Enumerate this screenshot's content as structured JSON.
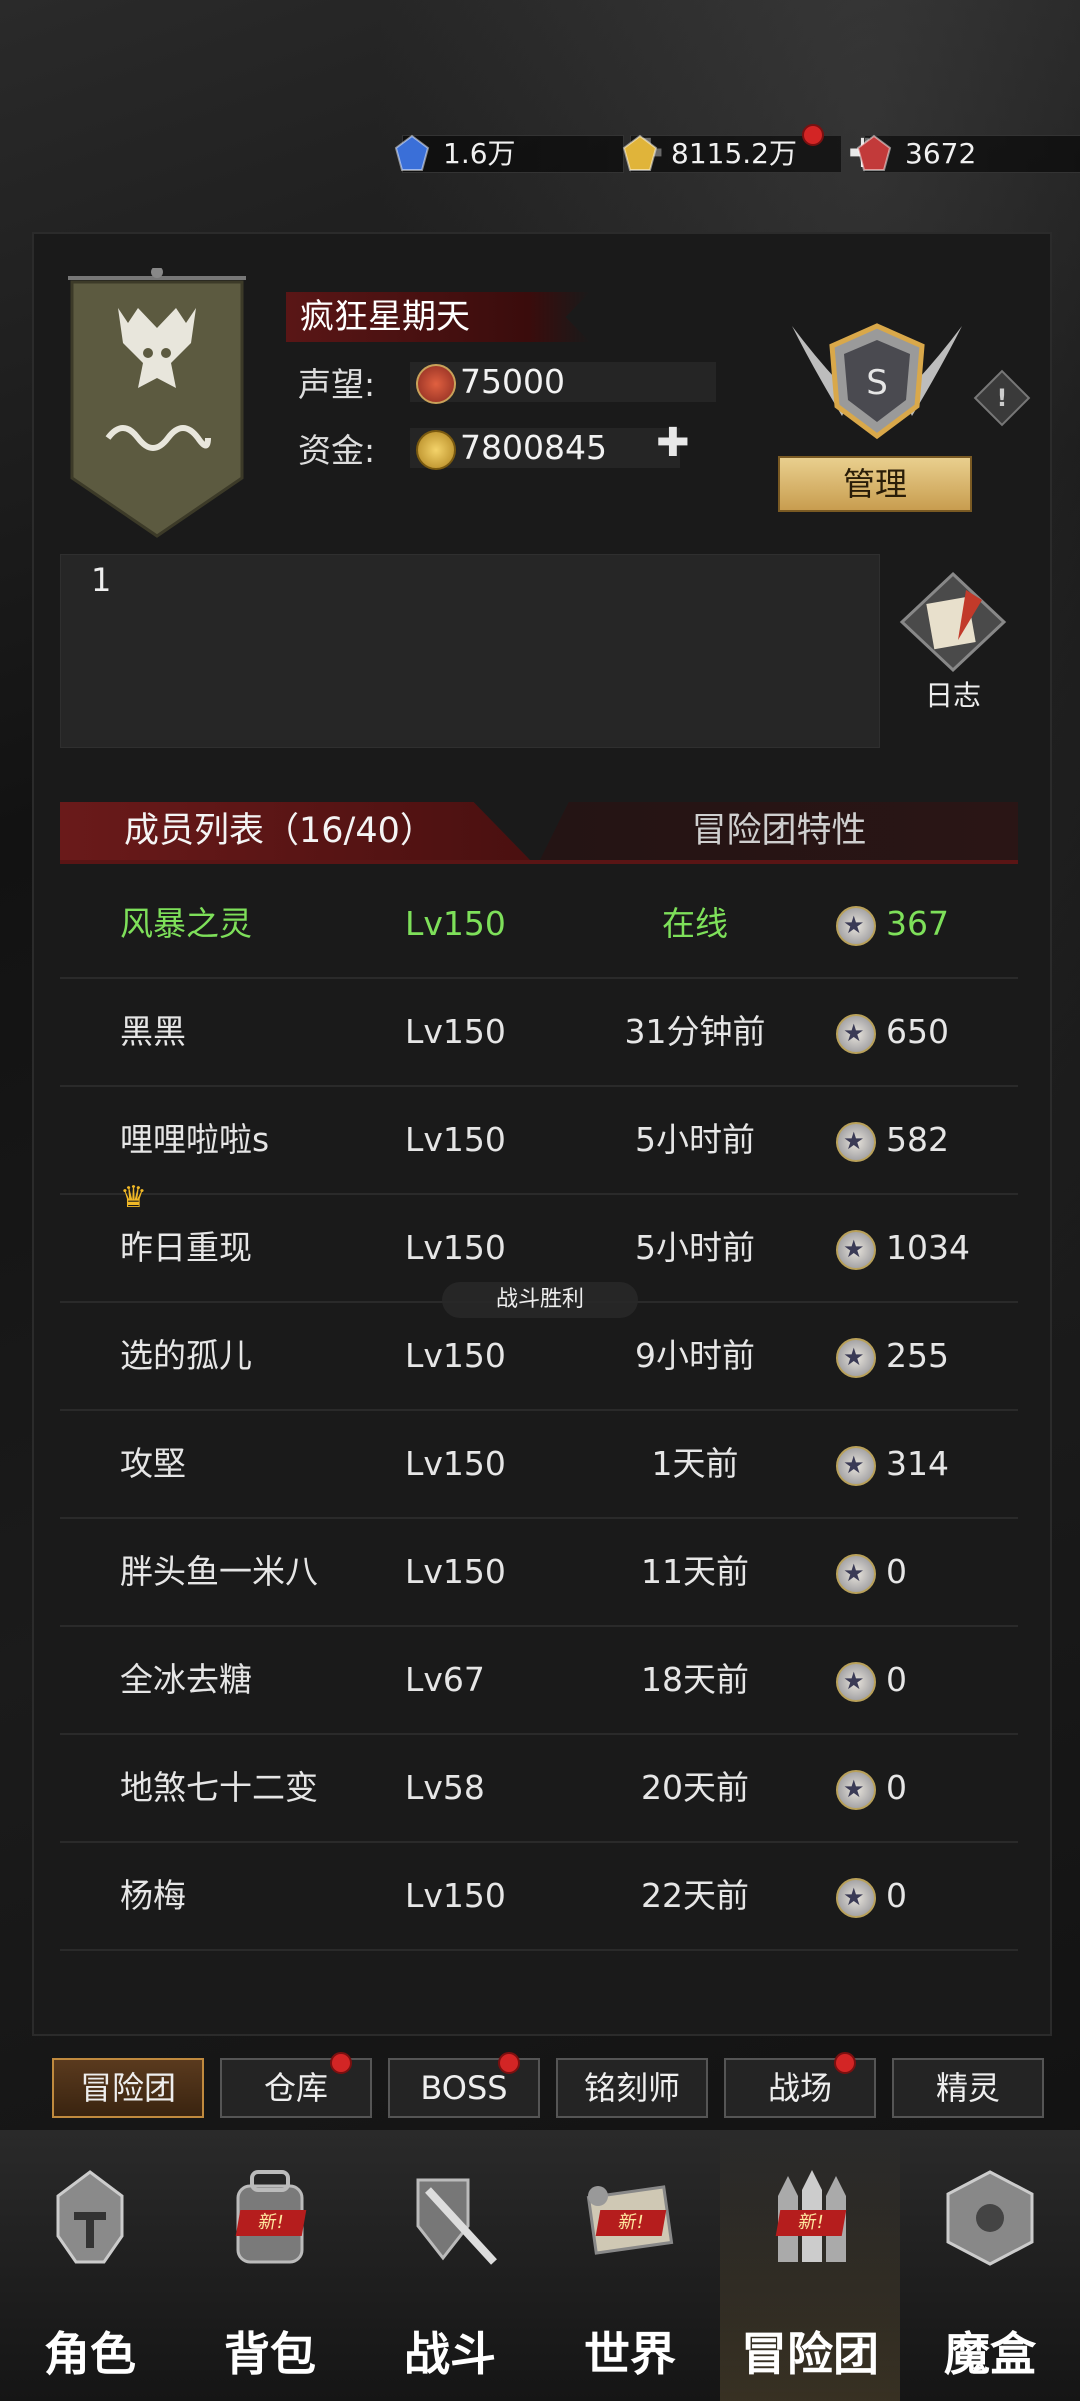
{
  "resources": [
    {
      "name": "blue-gem",
      "value": "1.6万",
      "color": "#3a6fd8",
      "plus": true,
      "dot": false
    },
    {
      "name": "gold-gem",
      "value": "8115.2万",
      "color": "#e0b43a",
      "plus": true,
      "dot": true
    },
    {
      "name": "red-gem",
      "value": "3672",
      "color": "#c23a3a",
      "plus": false,
      "dot": false
    }
  ],
  "guild": {
    "name": "疯狂星期天",
    "reputation_label": "声望:",
    "reputation": "75000",
    "funds_label": "资金:",
    "funds": "7800845",
    "rank": "S",
    "manage_label": "管理",
    "notice": "1",
    "log_label": "日志"
  },
  "tabs": {
    "members": "成员列表（16/40）",
    "traits": "冒险团特性"
  },
  "members": [
    {
      "name": "风暴之灵",
      "level": "Lv150",
      "last": "在线",
      "points": "367",
      "online": true,
      "crown": false
    },
    {
      "name": "黑黑",
      "level": "Lv150",
      "last": "31分钟前",
      "points": "650",
      "online": false,
      "crown": false
    },
    {
      "name": "哩哩啦啦s",
      "level": "Lv150",
      "last": "5小时前",
      "points": "582",
      "online": false,
      "crown": false
    },
    {
      "name": "昨日重现",
      "level": "Lv150",
      "last": "5小时前",
      "points": "1034",
      "online": false,
      "crown": true
    },
    {
      "name": "选的孤儿",
      "level": "Lv150",
      "last": "9小时前",
      "points": "255",
      "online": false,
      "crown": false
    },
    {
      "name": "攻堅",
      "level": "Lv150",
      "last": "1天前",
      "points": "314",
      "online": false,
      "crown": false
    },
    {
      "name": "胖头鱼一米八",
      "level": "Lv150",
      "last": "11天前",
      "points": "0",
      "online": false,
      "crown": false
    },
    {
      "name": "全冰去糖",
      "level": "Lv67",
      "last": "18天前",
      "points": "0",
      "online": false,
      "crown": false
    },
    {
      "name": "地煞七十二变",
      "level": "Lv58",
      "last": "20天前",
      "points": "0",
      "online": false,
      "crown": false
    },
    {
      "name": "杨梅",
      "level": "Lv150",
      "last": "22天前",
      "points": "0",
      "online": false,
      "crown": false
    }
  ],
  "toast": "战斗胜利",
  "subtabs": [
    {
      "label": "冒险团",
      "dot": false,
      "active": true
    },
    {
      "label": "仓库",
      "dot": true,
      "active": false
    },
    {
      "label": "BOSS",
      "dot": true,
      "active": false
    },
    {
      "label": "铭刻师",
      "dot": false,
      "active": false
    },
    {
      "label": "战场",
      "dot": true,
      "active": false
    },
    {
      "label": "精灵",
      "dot": false,
      "active": false
    }
  ],
  "nav": [
    {
      "label": "角色",
      "icon": "helmet-icon",
      "new": false,
      "active": false
    },
    {
      "label": "背包",
      "icon": "backpack-icon",
      "new": true,
      "active": false
    },
    {
      "label": "战斗",
      "icon": "sword-shield-icon",
      "new": false,
      "active": false
    },
    {
      "label": "世界",
      "icon": "scroll-map-icon",
      "new": true,
      "active": false
    },
    {
      "label": "冒险团",
      "icon": "castle-icon",
      "new": true,
      "active": true
    },
    {
      "label": "魔盒",
      "icon": "magic-cube-icon",
      "new": false,
      "active": false
    }
  ],
  "new_tag": "新!"
}
